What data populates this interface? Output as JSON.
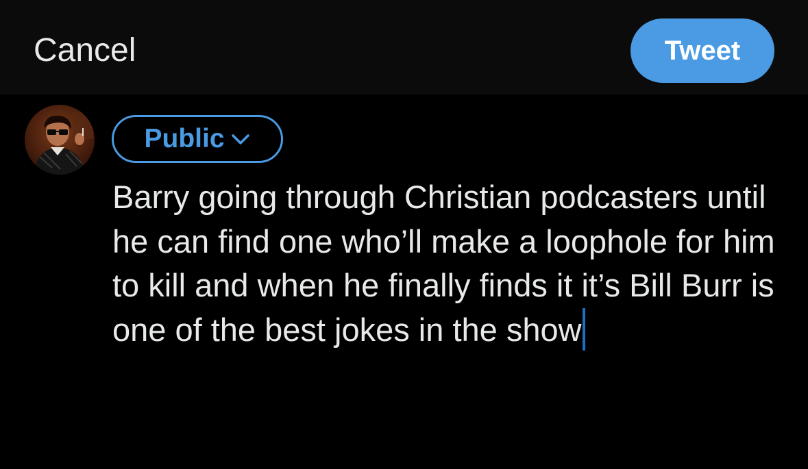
{
  "header": {
    "cancel_label": "Cancel",
    "tweet_label": "Tweet"
  },
  "composer": {
    "avatar_icon": "user-avatar-photo",
    "audience_label": "Public",
    "audience_icon": "chevron-down-icon",
    "text": "Barry going through Christian podcasters until he can find one who’ll make a loophole for him to kill and when he finally finds it it’s Bill Burr is one of the best jokes in the show"
  },
  "colors": {
    "background": "#000000",
    "header_background": "#0b0b0b",
    "accent": "#4a9be3",
    "text": "#e7e9ea",
    "caret": "#1d6fc4"
  }
}
